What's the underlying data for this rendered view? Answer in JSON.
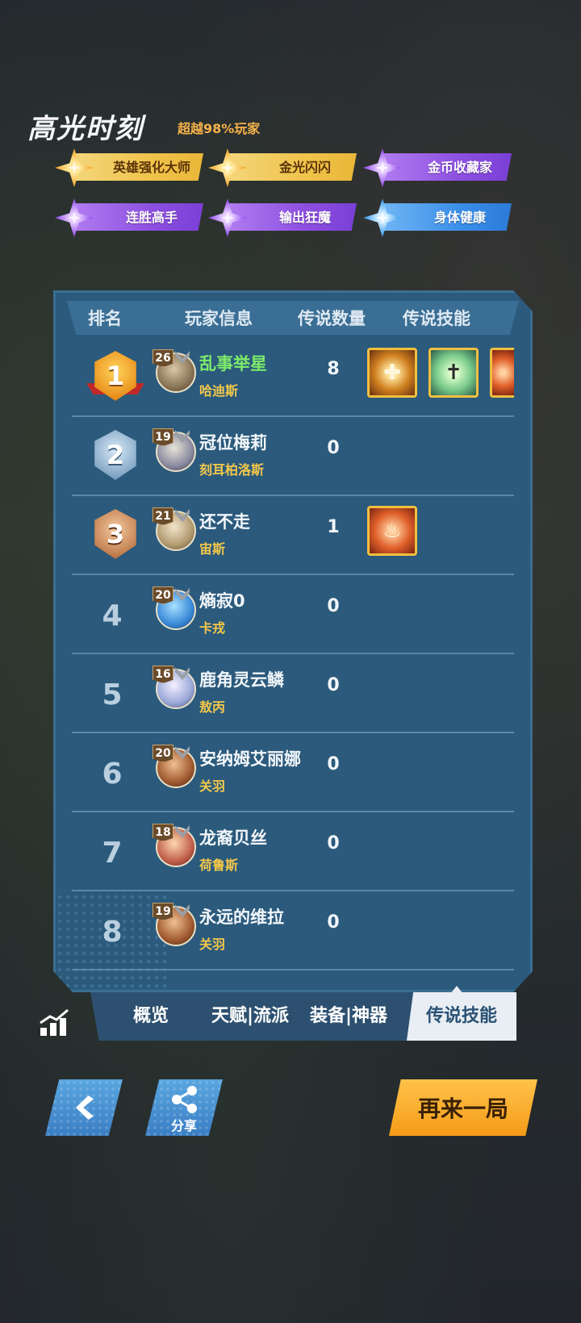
{
  "highlights": {
    "title": "高光时刻",
    "subtitle": "超越98%玩家",
    "badges": [
      {
        "label": "英雄强化大师",
        "tier": "gold",
        "icon": "gold-star-icon"
      },
      {
        "label": "金光闪闪",
        "tier": "gold",
        "icon": "gold-star-icon"
      },
      {
        "label": "金币收藏家",
        "tier": "purple",
        "icon": "purple-star-icon"
      },
      {
        "label": "连胜高手",
        "tier": "purple",
        "icon": "purple-star-icon"
      },
      {
        "label": "输出狂魔",
        "tier": "purple",
        "icon": "purple-star-icon"
      },
      {
        "label": "身体健康",
        "tier": "blue",
        "icon": "blue-star-icon"
      }
    ]
  },
  "table": {
    "headers": {
      "rank": "排名",
      "player": "玩家信息",
      "count": "传说数量",
      "skills": "传说技能"
    },
    "rows": [
      {
        "rank": "1",
        "level": "26",
        "name": "乱事举星",
        "hero": "哈迪斯",
        "count": "8",
        "highlight": true,
        "skills": [
          "sun-cross-skill-icon",
          "grave-skill-icon",
          "pot-skill-icon"
        ]
      },
      {
        "rank": "2",
        "level": "19",
        "name": "冠位梅莉",
        "hero": "刻耳柏洛斯",
        "count": "0",
        "skills": []
      },
      {
        "rank": "3",
        "level": "21",
        "name": "还不走",
        "hero": "宙斯",
        "count": "1",
        "skills": [
          "pot-skill-icon"
        ]
      },
      {
        "rank": "4",
        "level": "20",
        "name": "熵寂0",
        "hero": "卡戎",
        "count": "0",
        "skills": []
      },
      {
        "rank": "5",
        "level": "16",
        "name": "鹿角灵云鳞",
        "hero": "敖丙",
        "count": "0",
        "skills": []
      },
      {
        "rank": "6",
        "level": "20",
        "name": "安纳姆艾丽娜",
        "hero": "关羽",
        "count": "0",
        "skills": []
      },
      {
        "rank": "7",
        "level": "18",
        "name": "龙裔贝丝",
        "hero": "荷鲁斯",
        "count": "0",
        "skills": []
      },
      {
        "rank": "8",
        "level": "19",
        "name": "永远的维拉",
        "hero": "关羽",
        "count": "0",
        "skills": []
      }
    ]
  },
  "tabs": {
    "overview": "概览",
    "talent": "天赋|流派",
    "equipment": "装备|神器",
    "legend_skills": "传说技能",
    "active": "legend_skills"
  },
  "buttons": {
    "back_icon": "back-arrow-icon",
    "share_label": "分享",
    "again_label": "再来一局"
  },
  "colors": {
    "panel": "#2b5a7c",
    "highlight_name": "#7dea6a",
    "hero_name": "#f4c84a",
    "accent_orange": "#f59c18",
    "button_blue": "#3a7ec4"
  }
}
